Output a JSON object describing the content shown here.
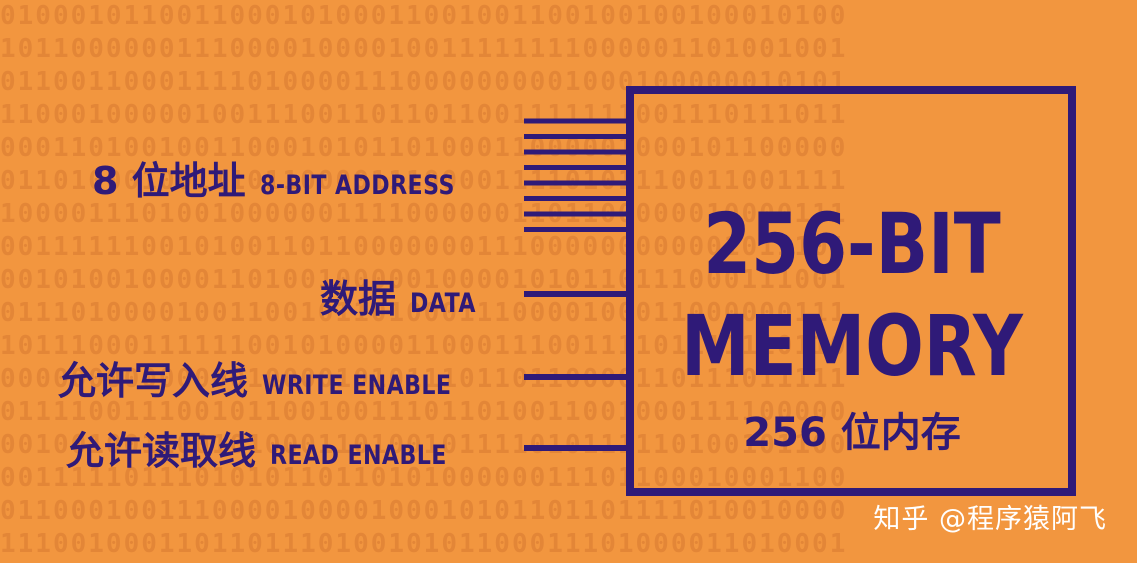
{
  "diagram": {
    "inputs": [
      {
        "zh": "8 位地址",
        "en": "8-BIT ADDRESS",
        "wires": 8
      },
      {
        "zh": "数据",
        "en": "DATA",
        "wires": 1
      },
      {
        "zh": "允许写入线",
        "en": "WRITE ENABLE",
        "wires": 1
      },
      {
        "zh": "允许读取线",
        "en": "READ ENABLE",
        "wires": 1
      }
    ],
    "memory": {
      "line1": "256-BIT",
      "line2": "MEMORY",
      "subtitle_zh": "256 位内存"
    }
  },
  "watermark": "知乎 @程序猿阿飞",
  "colors": {
    "background": "#f2963f",
    "ink": "#2f1a78",
    "watermark": "#ffffff"
  }
}
